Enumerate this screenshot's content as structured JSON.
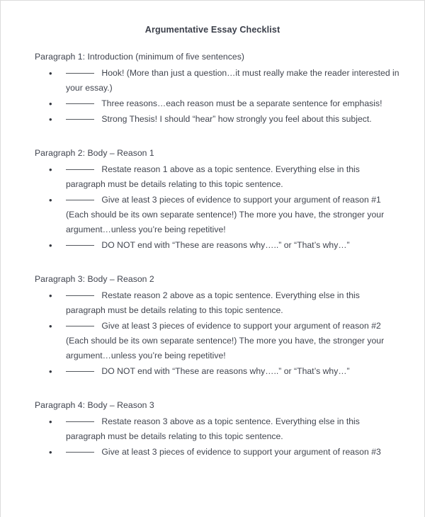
{
  "document": {
    "title": "Argumentative Essay Checklist",
    "bullet_glyph": "•",
    "blank_placeholder": "______",
    "text_color": "#41454f",
    "title_color": "#3b3f4a",
    "page_border_color": "#dcdcdc"
  },
  "sections": [
    {
      "heading": "Paragraph 1:  Introduction (minimum of five sentences)",
      "items": [
        "Hook!  (More than just a question…it must really make the reader interested in your essay.)",
        "Three reasons…each reason must be a separate sentence for emphasis!",
        "Strong Thesis!  I should “hear” how strongly you feel about this subject."
      ]
    },
    {
      "heading": "Paragraph 2:  Body – Reason 1",
      "items": [
        "Restate reason 1 above as a topic sentence.  Everything else in this paragraph must be details relating to this topic sentence.",
        "Give at least 3 pieces of evidence to support your argument of reason #1 (Each should be its own separate sentence!)  The more you have, the stronger your argument…unless you’re being repetitive!",
        "DO NOT end with “These are reasons why…..” or “That’s why…”"
      ]
    },
    {
      "heading": "Paragraph 3:  Body – Reason 2",
      "items": [
        "Restate reason 2 above as a topic sentence.  Everything else in this paragraph must be details relating to this topic sentence.",
        "Give at least 3 pieces of evidence to support your argument of reason #2 (Each should be its own separate sentence!)  The more you have, the stronger your argument…unless you’re being repetitive!",
        "DO NOT end with “These are reasons why…..” or “That’s why…”"
      ]
    },
    {
      "heading": "Paragraph 4:  Body – Reason 3",
      "items": [
        "Restate reason 3 above as a topic sentence.  Everything else in this paragraph must be details relating to this topic sentence.",
        "Give at least 3 pieces of evidence to support your argument of reason #3"
      ]
    }
  ]
}
